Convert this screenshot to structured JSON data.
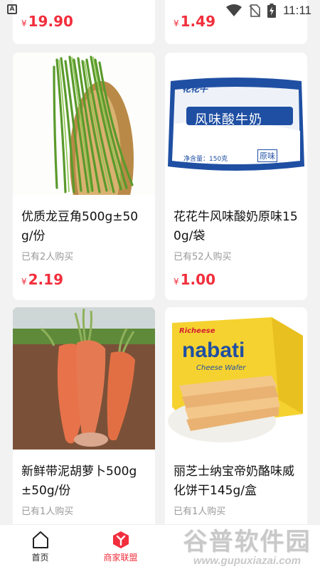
{
  "status_bar": {
    "time": "11:11",
    "left_icon": "A"
  },
  "top_prices": [
    {
      "currency": "¥",
      "value": "19.90"
    },
    {
      "currency": "¥",
      "value": "1.49"
    }
  ],
  "products": [
    {
      "title": "优质龙豆角500g±50g/份",
      "sold": "已有2人购买",
      "currency": "¥",
      "price": "2.19"
    },
    {
      "title": "花花牛风味酸奶原味150g/袋",
      "sold": "已有52人购买",
      "currency": "¥",
      "price": "1.00",
      "package_brand": "花花牛",
      "package_name": "风味酸牛奶",
      "package_weight": "净含量：150克",
      "package_flavor": "原味"
    },
    {
      "title": "新鲜带泥胡萝卜500g±50g/份",
      "sold": "已有1人购买"
    },
    {
      "title": "丽芝士纳宝帝奶酪味威化饼干145g/盒",
      "sold": "已有1人购买",
      "package_brand": "Richeese",
      "package_name": "nabati",
      "package_sub": "Cheese Wafer"
    }
  ],
  "nav": {
    "home": "首页",
    "alliance": "商家联盟"
  },
  "watermark": {
    "main": "谷普软件园",
    "url": "www.gupuxiazai.com"
  },
  "colors": {
    "price": "#f22e3c",
    "accent": "#f22e3c"
  }
}
